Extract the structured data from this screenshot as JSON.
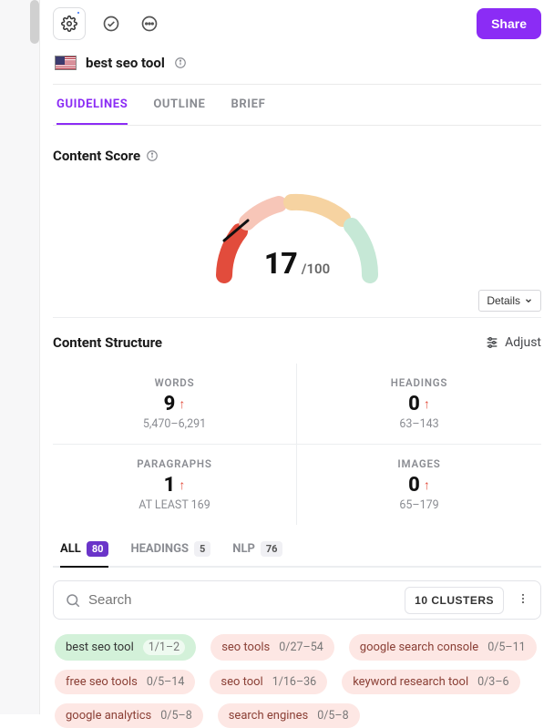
{
  "topbar": {
    "share_label": "Share"
  },
  "keyword": {
    "text": "best seo tool",
    "locale": "US"
  },
  "tabs": {
    "guidelines": "GUIDELINES",
    "outline": "OUTLINE",
    "brief": "BRIEF",
    "active": "guidelines"
  },
  "content_score": {
    "title": "Content Score",
    "value": "17",
    "max": "/100",
    "details_label": "Details"
  },
  "content_structure": {
    "title": "Content Structure",
    "adjust_label": "Adjust",
    "metrics": {
      "words": {
        "label": "WORDS",
        "value": "9",
        "range": "5,470–6,291"
      },
      "headings": {
        "label": "HEADINGS",
        "value": "0",
        "range": "63–143"
      },
      "paragraphs": {
        "label": "PARAGRAPHS",
        "value": "1",
        "range": "AT LEAST 169"
      },
      "images": {
        "label": "IMAGES",
        "value": "0",
        "range": "65–179"
      }
    }
  },
  "term_tabs": {
    "all": {
      "label": "ALL",
      "count": "80"
    },
    "headings": {
      "label": "HEADINGS",
      "count": "5"
    },
    "nlp": {
      "label": "NLP",
      "count": "76"
    }
  },
  "search": {
    "placeholder": "Search",
    "clusters_label": "10 CLUSTERS"
  },
  "terms": [
    {
      "text": "best seo tool",
      "range": "1/1–2",
      "status": "good"
    },
    {
      "text": "seo tools",
      "range": "0/27–54",
      "status": "warn"
    },
    {
      "text": "google search console",
      "range": "0/5–11",
      "status": "warn"
    },
    {
      "text": "free seo tools",
      "range": "0/5–14",
      "status": "warn"
    },
    {
      "text": "seo tool",
      "range": "1/16–36",
      "status": "warn"
    },
    {
      "text": "keyword research tool",
      "range": "0/3–6",
      "status": "warn"
    },
    {
      "text": "google analytics",
      "range": "0/5–8",
      "status": "warn"
    },
    {
      "text": "search engines",
      "range": "0/5–8",
      "status": "warn"
    }
  ]
}
